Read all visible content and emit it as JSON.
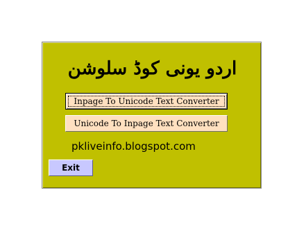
{
  "form": {
    "title": "اردو یونی کوڈ سلوشن",
    "buttons": {
      "inpage_to_unicode": "Inpage To Unicode Text Converter",
      "unicode_to_inpage": "Unicode To Inpage Text Converter",
      "exit": "Exit"
    },
    "website": "pkliveinfo.blogspot.com"
  },
  "colors": {
    "panel_background": "#c0c000",
    "converter_button": "#ffe0c0",
    "exit_button": "#c8c8ff"
  }
}
